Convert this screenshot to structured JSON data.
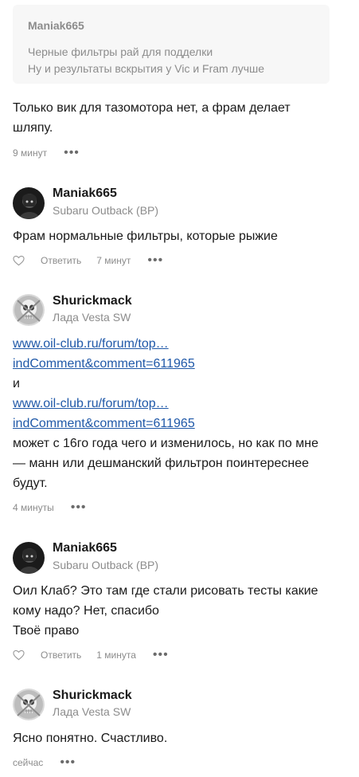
{
  "quote": {
    "author": "Maniak665",
    "lines": [
      "Черные фильтры рай для подделки",
      "Ну и результаты вскрытия у Vic и Fram лучше"
    ]
  },
  "c0": {
    "lines": [
      "Только вик для тазомотора нет, а фрам делает",
      "шляпу."
    ],
    "time": "9 минут"
  },
  "c1": {
    "author": "Maniak665",
    "car": "Subaru Outback (BP)",
    "lines": [
      "Фрам нормальные фильтры, которые рыжие"
    ],
    "reply": "Ответить",
    "time": "7 минут"
  },
  "c2": {
    "author": "Shurickmack",
    "car": "Лада Vesta SW",
    "link1a": "www.oil-club.ru/forum/top…",
    "link1b": "indComment&comment=611965",
    "and": "и",
    "link2a": "www.oil-club.ru/forum/top…",
    "link2b": "indComment&comment=611965",
    "lines": [
      "может с 16го года чего и изменилось, но как по мне",
      "— манн или дешманский фильтрон поинтереснее",
      "будут."
    ],
    "time": "4 минуты"
  },
  "c3": {
    "author": "Maniak665",
    "car": "Subaru Outback (BP)",
    "lines": [
      "Оил Клаб? Это там где стали рисовать тесты какие",
      "кому надо? Нет, спасибо",
      "Твоё право"
    ],
    "reply": "Ответить",
    "time": "1 минута"
  },
  "c4": {
    "author": "Shurickmack",
    "car": "Лада Vesta SW",
    "lines": [
      "Ясно понятно. Счастливо."
    ],
    "time": "сейчас"
  },
  "icons": {
    "more": "more-dots-icon",
    "like": "heart-icon"
  },
  "colors": {
    "link": "#1f58a8",
    "muted": "#8c8c8c",
    "quote_bg": "#f7f7f7"
  }
}
